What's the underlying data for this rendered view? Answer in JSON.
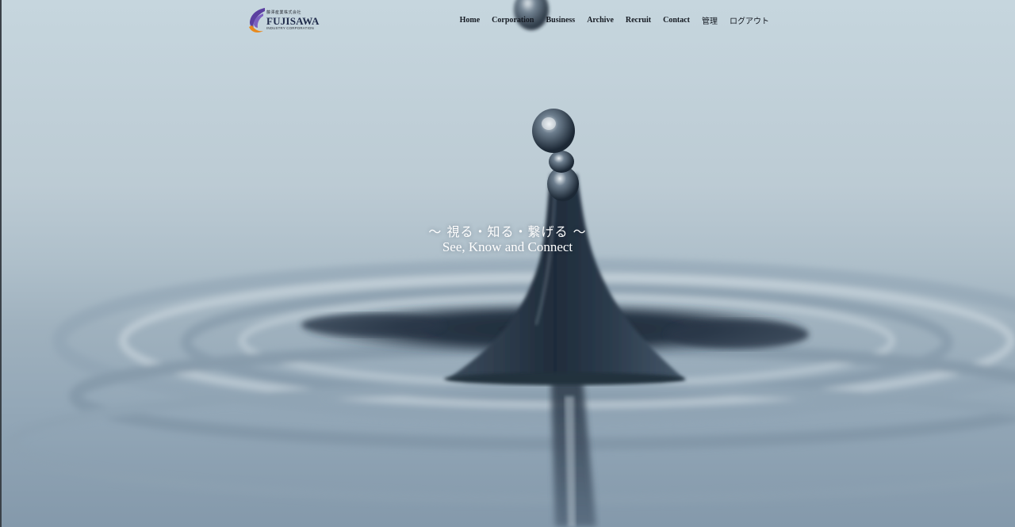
{
  "header": {
    "logo": {
      "jp_name": "藤澤産業株式会社",
      "name": "FUJISAWA",
      "subtitle": "INDUSTRY CORPORATION",
      "mark_icon": "fujisawa-swoosh-logo",
      "mark_colors": [
        "#5b3fa0",
        "#e8891c"
      ]
    },
    "nav": [
      {
        "label": "Home"
      },
      {
        "label": "Corporation"
      },
      {
        "label": "Business"
      },
      {
        "label": "Archive"
      },
      {
        "label": "Recruit"
      },
      {
        "label": "Contact"
      },
      {
        "label": "管理"
      },
      {
        "label": "ログアウト"
      }
    ]
  },
  "hero": {
    "tagline_jp": "〜 視る・知る・繋げる 〜",
    "tagline_en": "See, Know and Connect",
    "background": "water-droplet-splash-photo",
    "colors": {
      "sky_top": "#c4d4dc",
      "water_mid": "#a8b9c5",
      "water_dark": "#2c3a4a",
      "water_bottom": "#7f93a5"
    }
  }
}
